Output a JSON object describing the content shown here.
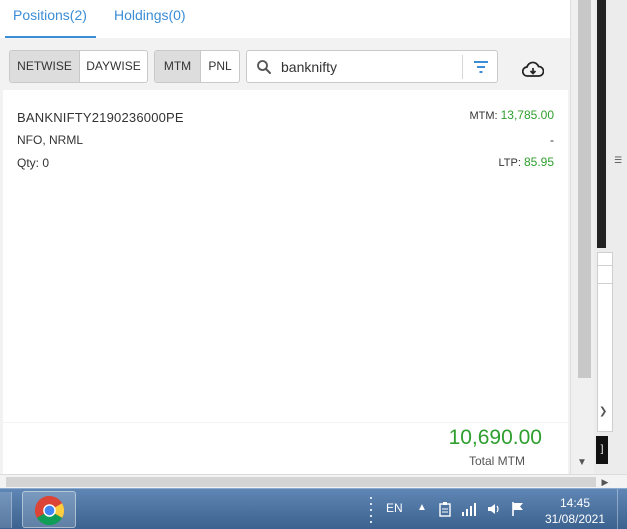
{
  "tabs": {
    "positions_label": "Positions(2)",
    "holdings_label": "Holdings(0)"
  },
  "toolbar": {
    "netwise_label": "NETWISE",
    "daywise_label": "DAYWISE",
    "mtm_label": "MTM",
    "pnl_label": "PNL",
    "search_value": "banknifty",
    "icons": [
      "search-icon",
      "filter-icon",
      "cloud-download-icon"
    ]
  },
  "position": {
    "symbol": "BANKNIFTY2190236000PE",
    "exchange_product": "NFO, NRML",
    "qty_label": "Qty:",
    "qty_value": "0",
    "mtm_label": "MTM:",
    "mtm_value": "13,785.00",
    "middle_value": "-",
    "ltp_label": "LTP:",
    "ltp_value": "85.95"
  },
  "footer": {
    "total_value": "10,690.00",
    "total_label": "Total MTM"
  },
  "taskbar": {
    "language": "EN",
    "time": "14:45",
    "date": "31/08/2021"
  },
  "colors": {
    "accent_blue": "#3b8dd6",
    "positive_green": "#2e9e2e",
    "taskbar_blue": "#4a709e"
  }
}
